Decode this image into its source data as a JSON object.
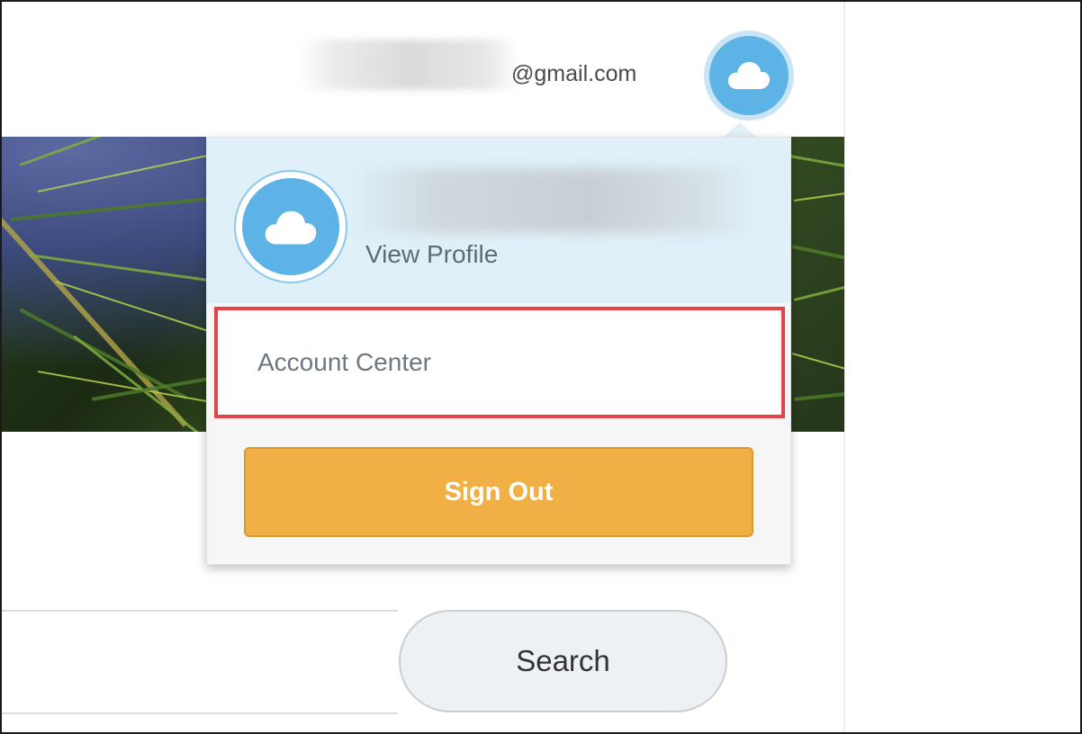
{
  "header": {
    "email_suffix": "@gmail.com",
    "avatar_icon": "cloud-icon"
  },
  "menu": {
    "avatar_icon": "cloud-icon",
    "view_profile_label": "View Profile",
    "account_center_label": "Account Center",
    "sign_out_label": "Sign Out"
  },
  "search": {
    "button_label": "Search"
  },
  "colors": {
    "avatar_blue": "#5db2e6",
    "menu_header_bg": "#dff0f9",
    "highlight_red": "#e0454a",
    "sign_out_orange": "#f0b046"
  }
}
